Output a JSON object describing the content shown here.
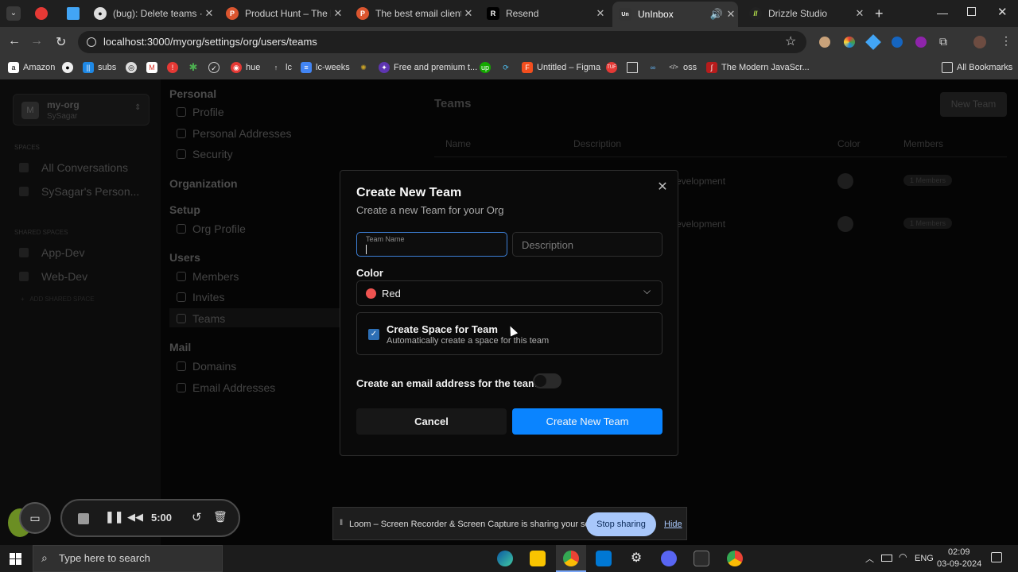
{
  "tabs": [
    {
      "title": "",
      "color": "#e53935"
    },
    {
      "title": "",
      "color": "#42a5f5"
    },
    {
      "title": "(bug): Delete teams · Iss",
      "color": "#9e9e9e"
    },
    {
      "title": "Product Hunt – The best",
      "color": "#da552f"
    },
    {
      "title": "The best email clients in",
      "color": "#da552f"
    },
    {
      "title": "Resend",
      "color": "#000000"
    },
    {
      "title": "UnInbox",
      "color": "#333333"
    },
    {
      "title": "Drizzle Studio",
      "color": "#c5f74f"
    }
  ],
  "url": "localhost:3000/myorg/settings/org/users/teams",
  "bookmarks": [
    "Amazon",
    "subs",
    "hue",
    "lc",
    "lc-weeks",
    "Free and premium t...",
    "Untitled – Figma",
    "oss",
    "The Modern JavaScr...",
    "All Bookmarks"
  ],
  "sidebar": {
    "org_initial": "M",
    "org_name": "my-org",
    "user_name": "SySagar",
    "spaces_label": "SPACES",
    "spaces": [
      "All Conversations",
      "SySagar's Person..."
    ],
    "shared_label": "SHARED SPACES",
    "shared": [
      "App-Dev",
      "Web-Dev"
    ],
    "add_shared": "ADD SHARED SPACE"
  },
  "settings_nav": {
    "personal": "Personal",
    "personal_items": [
      "Profile",
      "Personal Addresses",
      "Security"
    ],
    "organization": "Organization",
    "setup": "Setup",
    "setup_items": [
      "Org Profile"
    ],
    "users": "Users",
    "users_items": [
      "Members",
      "Invites",
      "Teams"
    ],
    "mail": "Mail",
    "mail_items": [
      "Domains",
      "Email Addresses"
    ]
  },
  "teams_page": {
    "title": "Teams",
    "new_team": "New Team",
    "columns": [
      "Name",
      "Description",
      "Color",
      "Members"
    ],
    "rows": [
      {
        "description": "evelopment",
        "members": "1 Members"
      },
      {
        "description": "evelopment",
        "members": "1 Members"
      }
    ]
  },
  "dialog": {
    "title": "Create New Team",
    "subtitle": "Create a new Team for your Org",
    "team_name_label": "Team Name",
    "description_placeholder": "Description",
    "color_label": "Color",
    "color_value": "Red",
    "color_hex": "#ef5350",
    "space_title": "Create Space for Team",
    "space_sub": "Automatically create a space for this team",
    "space_checked": true,
    "email_label": "Create an email address for the team",
    "email_enabled": false,
    "cancel": "Cancel",
    "create": "Create New Team"
  },
  "loom": {
    "timer": "5:00",
    "message": "Loom – Screen Recorder & Screen Capture is sharing your screen.",
    "stop": "Stop sharing",
    "hide": "Hide"
  },
  "taskbar": {
    "search_placeholder": "Type here to search",
    "lang": "ENG",
    "time": "02:09",
    "date": "03-09-2024"
  }
}
